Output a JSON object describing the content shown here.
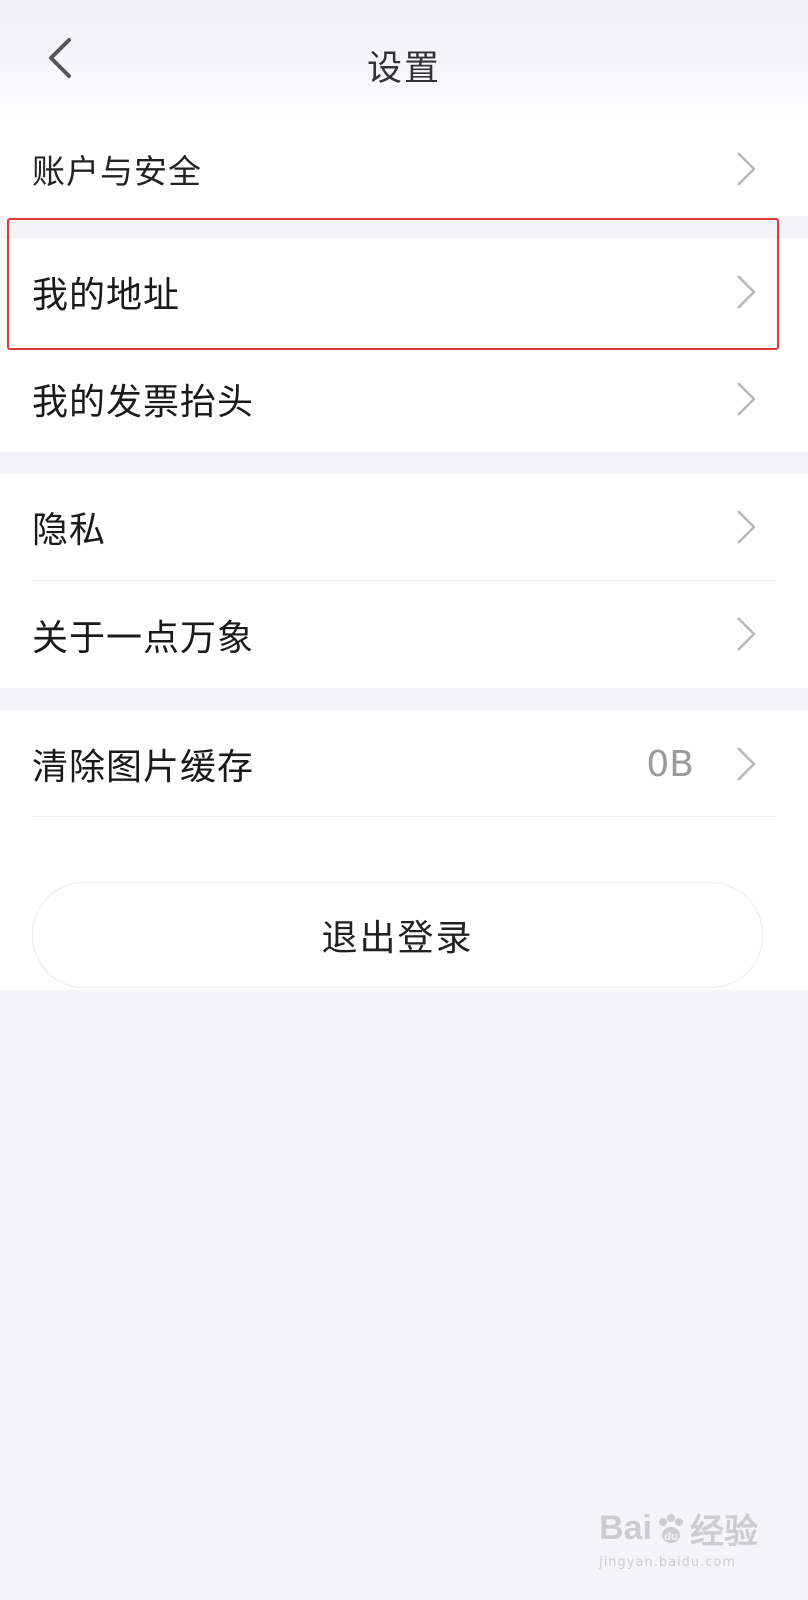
{
  "header": {
    "title": "设置",
    "back_icon": "chevron-left-icon"
  },
  "groups": {
    "account": {
      "label": "账户与安全"
    },
    "info": {
      "address": "我的地址",
      "invoice": "我的发票抬头"
    },
    "misc": {
      "privacy": "隐私",
      "about": "关于一点万象"
    },
    "cache": {
      "label": "清除图片缓存",
      "value": "0B"
    }
  },
  "logout": {
    "label": "退出登录"
  },
  "watermark": {
    "logo_text": "Bai",
    "logo_suffix": "经验",
    "subtext": "jingyan.baidu.com"
  },
  "colors": {
    "highlight": "#e53935",
    "background": "#f4f4f9",
    "chevron": "#b8b8b8"
  }
}
